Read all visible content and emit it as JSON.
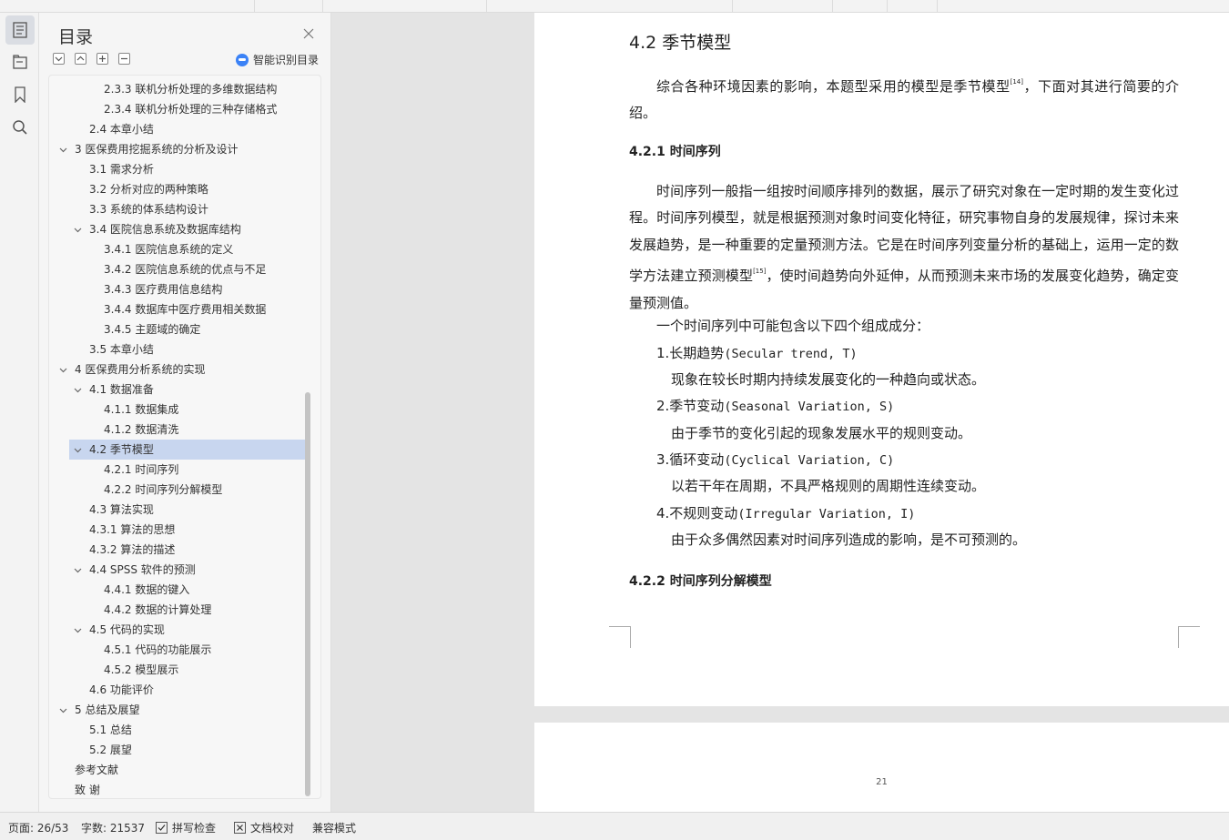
{
  "toc_panel": {
    "title": "目录",
    "smart_toc_label": "智能识别目录",
    "items": [
      {
        "label": "2.3.3  联机分析处理的多维数据结构",
        "level": 3,
        "expanded": null
      },
      {
        "label": "2.3.4  联机分析处理的三种存储格式",
        "level": 3,
        "expanded": null
      },
      {
        "label": "2.4  本章小结",
        "level": 2,
        "expanded": null
      },
      {
        "label": "3  医保费用挖掘系统的分析及设计",
        "level": 1,
        "expanded": true
      },
      {
        "label": "3.1  需求分析",
        "level": 2,
        "expanded": null
      },
      {
        "label": "3.2 分析对应的两种策略",
        "level": 2,
        "expanded": null
      },
      {
        "label": "3.3  系统的体系结构设计",
        "level": 2,
        "expanded": null
      },
      {
        "label": "3.4 医院信息系统及数据库结构",
        "level": 2,
        "expanded": true
      },
      {
        "label": "3.4.1 医院信息系统的定义",
        "level": 3,
        "expanded": null
      },
      {
        "label": "3.4.2 医院信息系统的优点与不足",
        "level": 3,
        "expanded": null
      },
      {
        "label": "3.4.3 医疗费用信息结构",
        "level": 3,
        "expanded": null
      },
      {
        "label": "3.4.4  数据库中医疗费用相关数据",
        "level": 3,
        "expanded": null
      },
      {
        "label": "3.4.5 主题域的确定",
        "level": 3,
        "expanded": null
      },
      {
        "label": "3.5    本章小结",
        "level": 2,
        "expanded": null
      },
      {
        "label": "4  医保费用分析系统的实现",
        "level": 1,
        "expanded": true
      },
      {
        "label": "4.1  数据准备",
        "level": 2,
        "expanded": true
      },
      {
        "label": "4.1.1  数据集成",
        "level": 3,
        "expanded": null
      },
      {
        "label": "4.1.2  数据清洗",
        "level": 3,
        "expanded": null
      },
      {
        "label": "4.2 季节模型",
        "level": 2,
        "expanded": true,
        "selected": true
      },
      {
        "label": "4.2.1 时间序列",
        "level": 3,
        "expanded": null
      },
      {
        "label": "4.2.2  时间序列分解模型",
        "level": 3,
        "expanded": null
      },
      {
        "label": "4.3 算法实现",
        "level": 2,
        "expanded": null
      },
      {
        "label": "4.3.1 算法的思想",
        "level": 2,
        "expanded": null
      },
      {
        "label": "4.3.2 算法的描述",
        "level": 2,
        "expanded": null
      },
      {
        "label": "4.4 SPSS 软件的预测",
        "level": 2,
        "expanded": true
      },
      {
        "label": "4.4.1  数据的键入",
        "level": 3,
        "expanded": null
      },
      {
        "label": "4.4.2 数据的计算处理",
        "level": 3,
        "expanded": null
      },
      {
        "label": "4.5  代码的实现",
        "level": 2,
        "expanded": true
      },
      {
        "label": "4.5.1 代码的功能展示",
        "level": 3,
        "expanded": null
      },
      {
        "label": "4.5.2  模型展示",
        "level": 3,
        "expanded": null
      },
      {
        "label": "4.6 功能评价",
        "level": 2,
        "expanded": null
      },
      {
        "label": "5  总结及展望",
        "level": 1,
        "expanded": true
      },
      {
        "label": "5.1 总结",
        "level": 2,
        "expanded": null
      },
      {
        "label": "5.2  展望",
        "level": 2,
        "expanded": null
      },
      {
        "label": "参考文献",
        "level": 0,
        "expanded": null
      },
      {
        "label": "致  谢",
        "level": 0,
        "expanded": null
      }
    ]
  },
  "document": {
    "heading": "4.2 季节模型",
    "intro_before_ref": "综合各种环境因素的影响，本题型采用的模型是季节模型",
    "intro_ref": "[14]",
    "intro_after_ref": "，下面对其进行简要的介绍。",
    "sub_heading_1": "4.2.1 时间序列",
    "ts_para_before_ref": "时间序列一般指一组按时间顺序排列的数据，展示了研究对象在一定时期的发生变化过程。时间序列模型，就是根据预测对象时间变化特征，研究事物自身的发展规律，探讨未来发展趋势，是一种重要的定量预测方法。它是在时间序列变量分析的基础上，运用一定的数学方法建立预测模型",
    "ts_ref": "[15]",
    "ts_para_after_ref": "，使时间趋势向外延伸，从而预测未来市场的发展变化趋势，确定变量预测值。",
    "components_intro": "一个时间序列中可能包含以下四个组成成分：",
    "components": [
      {
        "title": "1.长期趋势",
        "term": "(Secular trend, T)",
        "desc": "现象在较长时期内持续发展变化的一种趋向或状态。"
      },
      {
        "title": "2.季节变动",
        "term": "(Seasonal Variation, S)",
        "desc": "由于季节的变化引起的现象发展水平的规则变动。"
      },
      {
        "title": "3.循环变动",
        "term": "(Cyclical Variation, C)",
        "desc": "以若干年在周期，不具严格规则的周期性连续变动。"
      },
      {
        "title": "4.不规则变动",
        "term": "(Irregular Variation, I)",
        "desc": "由于众多偶然因素对时间序列造成的影响，是不可预测的。"
      }
    ],
    "sub_heading_2": "4.2.2  时间序列分解模型",
    "next_page_number": "21"
  },
  "status_bar": {
    "page": "页面: 26/53",
    "word_count": "字数: 21537",
    "spell_check": "拼写检查",
    "doc_proof": "文档校对",
    "compat_mode": "兼容模式"
  }
}
